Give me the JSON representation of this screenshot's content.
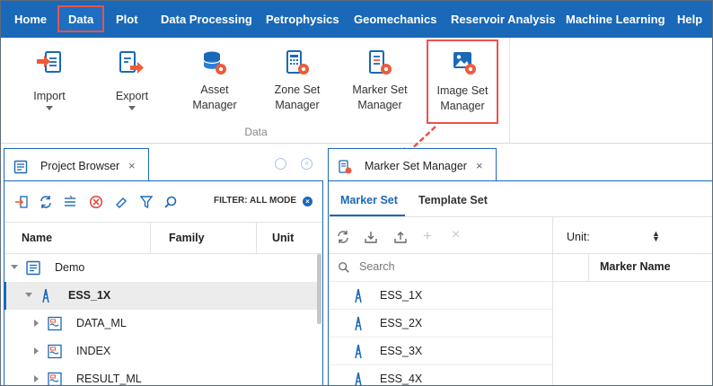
{
  "menu": {
    "items": [
      {
        "label": "Home"
      },
      {
        "label": "Data"
      },
      {
        "label": "Plot"
      },
      {
        "label": "Data Processing"
      },
      {
        "label": "Petrophysics"
      },
      {
        "label": "Geomechanics"
      },
      {
        "label": "Reservoir Analysis"
      },
      {
        "label": "Machine Learning"
      },
      {
        "label": "Help"
      }
    ],
    "active": "Data"
  },
  "ribbon": {
    "buttons": [
      {
        "label": "Import",
        "icon": "import-icon"
      },
      {
        "label": "Export",
        "icon": "export-icon"
      },
      {
        "label": "Asset\nManager",
        "icon": "asset-manager-icon"
      },
      {
        "label": "Zone Set\nManager",
        "icon": "zone-set-manager-icon"
      },
      {
        "label": "Marker Set\nManager",
        "icon": "marker-set-manager-icon"
      },
      {
        "label": "Image Set\nManager",
        "icon": "image-set-manager-icon"
      }
    ],
    "group_label": "Data",
    "highlighted": "Image Set Manager"
  },
  "colors": {
    "primary": "#1a68b8",
    "highlight": "#e8534a",
    "accent_orange": "#ef5a38"
  },
  "project_browser": {
    "tab_label": "Project Browser",
    "filter_label": "FILTER: ALL MODE",
    "columns": {
      "name": "Name",
      "family": "Family",
      "unit": "Unit"
    },
    "tree": [
      {
        "label": "Demo",
        "level": 0,
        "expanded": true,
        "icon": "project-icon",
        "bold": false,
        "selected": false
      },
      {
        "label": "ESS_1X",
        "level": 1,
        "expanded": true,
        "icon": "well-icon",
        "bold": true,
        "selected": true
      },
      {
        "label": "DATA_ML",
        "level": 2,
        "expanded": false,
        "icon": "dataset-icon",
        "bold": false,
        "selected": false
      },
      {
        "label": "INDEX",
        "level": 2,
        "expanded": false,
        "icon": "dataset-icon",
        "bold": false,
        "selected": false
      },
      {
        "label": "RESULT_ML",
        "level": 2,
        "expanded": false,
        "icon": "dataset-icon",
        "bold": false,
        "selected": false
      }
    ]
  },
  "marker_set_manager": {
    "tab_label": "Marker Set Manager",
    "subtabs": [
      {
        "label": "Marker Set",
        "active": true
      },
      {
        "label": "Template Set",
        "active": false
      }
    ],
    "search_placeholder": "Search",
    "wells": [
      "ESS_1X",
      "ESS_2X",
      "ESS_3X",
      "ESS_4X"
    ],
    "unit_label": "Unit:",
    "marker_name_header": "Marker Name"
  }
}
